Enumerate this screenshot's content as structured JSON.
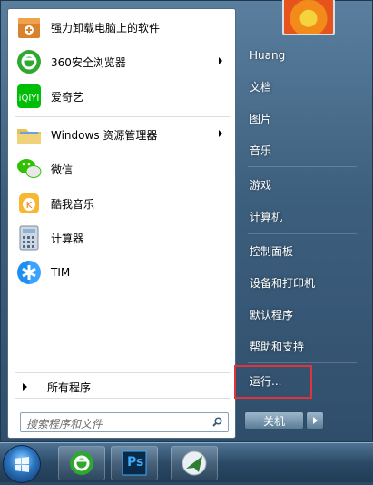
{
  "left_pane": {
    "programs": [
      {
        "label": "强力卸载电脑上的软件",
        "icon": "uninstall-box-icon",
        "submenu": false
      },
      {
        "label": "360安全浏览器",
        "icon": "360-browser-icon",
        "submenu": true
      },
      {
        "label": "爱奇艺",
        "icon": "iqiyi-icon",
        "submenu": false
      },
      {
        "label": "Windows 资源管理器",
        "icon": "file-explorer-icon",
        "submenu": true
      },
      {
        "label": "微信",
        "icon": "wechat-icon",
        "submenu": false
      },
      {
        "label": "酷我音乐",
        "icon": "kuwo-music-icon",
        "submenu": false
      },
      {
        "label": "计算器",
        "icon": "calculator-icon",
        "submenu": false
      },
      {
        "label": "TIM",
        "icon": "tim-icon",
        "submenu": false
      }
    ],
    "all_programs_label": "所有程序",
    "search_placeholder": "搜索程序和文件"
  },
  "right_pane": {
    "items": [
      "Huang",
      "文档",
      "图片",
      "音乐",
      "游戏",
      "计算机",
      "控制面板",
      "设备和打印机",
      "默认程序",
      "帮助和支持",
      "运行..."
    ],
    "shutdown_label": "关机"
  },
  "taskbar": {
    "items": [
      "start-orb",
      "360-browser-icon",
      "photoshop-icon",
      "feiq-icon"
    ],
    "ps_label": "Ps"
  },
  "colors": {
    "highlight_box": "#e0343a",
    "menu_right_bg": "#3d5f7e"
  }
}
